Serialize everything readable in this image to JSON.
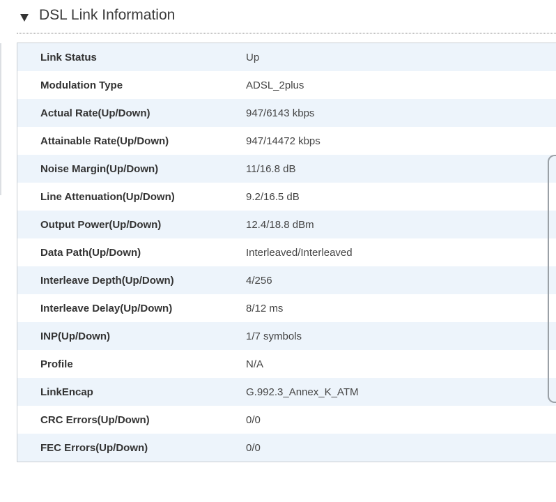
{
  "section": {
    "title": "DSL Link Information",
    "toggle_icon": "triangle-down-icon"
  },
  "rows": [
    {
      "label": "Link Status",
      "value": "Up"
    },
    {
      "label": "Modulation Type",
      "value": "ADSL_2plus"
    },
    {
      "label": "Actual Rate(Up/Down)",
      "value": "947/6143 kbps"
    },
    {
      "label": "Attainable Rate(Up/Down)",
      "value": "947/14472 kbps"
    },
    {
      "label": "Noise Margin(Up/Down)",
      "value": "11/16.8 dB"
    },
    {
      "label": "Line Attenuation(Up/Down)",
      "value": "9.2/16.5 dB"
    },
    {
      "label": "Output Power(Up/Down)",
      "value": "12.4/18.8 dBm"
    },
    {
      "label": "Data Path(Up/Down)",
      "value": "Interleaved/Interleaved"
    },
    {
      "label": "Interleave Depth(Up/Down)",
      "value": "4/256"
    },
    {
      "label": "Interleave Delay(Up/Down)",
      "value": "8/12 ms"
    },
    {
      "label": "INP(Up/Down)",
      "value": "1/7 symbols"
    },
    {
      "label": "Profile",
      "value": "N/A"
    },
    {
      "label": "LinkEncap",
      "value": "G.992.3_Annex_K_ATM"
    },
    {
      "label": "CRC Errors(Up/Down)",
      "value": "0/0"
    },
    {
      "label": "FEC Errors(Up/Down)",
      "value": "0/0"
    }
  ]
}
